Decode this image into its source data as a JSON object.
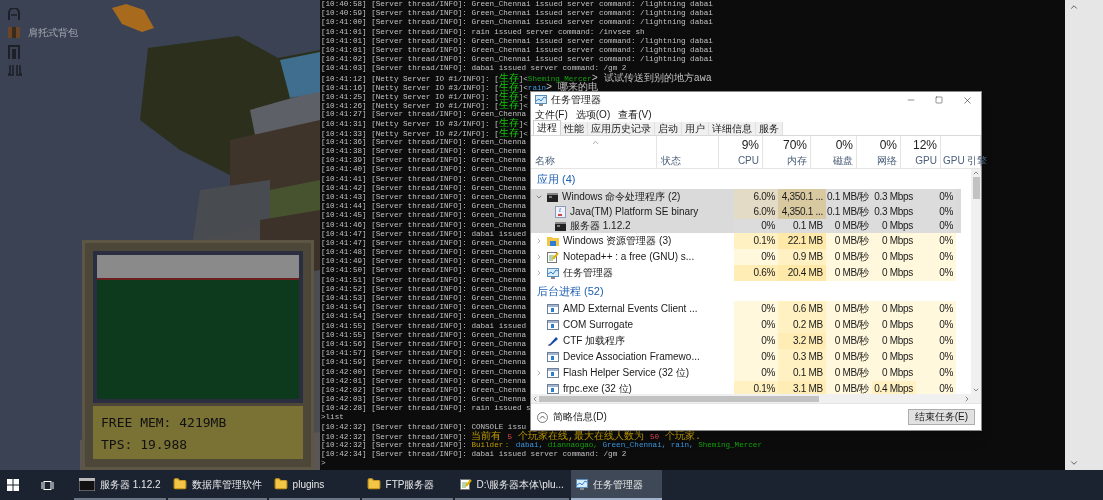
{
  "game": {
    "item_label": "肩托式背包",
    "free_mem": "FREE MEM: 4219MB",
    "tps": "TPS: 19.988"
  },
  "console": {
    "lines": [
      {
        "text": "[10:40:58] [Server thread/INFO]: Green_Chennai issued server command: /lightning dabai"
      },
      {
        "text": "[10:40:59] [Server thread/INFO]: Green_Chennai issued server command: /lightning dabai"
      },
      {
        "text": "[10:41:00] [Server thread/INFO]: Green_Chennai issued server command: /lightning dabai"
      },
      {
        "text": "[10:41:01] [Server thread/INFO]: rain issued server command: /invsee sh"
      },
      {
        "text": "[10:41:01] [Server thread/INFO]: Green_Chennai issued server command: /lightning dabai"
      },
      {
        "text": "[10:41:01] [Server thread/INFO]: Green_Chennai issued server command: /lightning dabai"
      },
      {
        "text": "[10:41:02] [Server thread/INFO]: Green_Chennai issued server command: /lightning dabai"
      },
      {
        "text": "[10:41:03] [Server thread/INFO]: dabai issued server command: /gm 2"
      },
      {
        "parts": [
          {
            "text": "[10:41:12] [Netty Server IO #1/INFO]: ["
          },
          {
            "text": "生存",
            "kind": "tag"
          },
          {
            "text": "]<"
          },
          {
            "text": "Sheming_Mercer",
            "kind": "player"
          },
          {
            "text": "> 试试传送到别的地方awa"
          }
        ]
      },
      {
        "parts": [
          {
            "text": "[10:41:16] [Netty Server IO #3/INFO]: ["
          },
          {
            "text": "生存",
            "kind": "tag"
          },
          {
            "text": "]<"
          },
          {
            "text": "rain",
            "kind": "operator"
          },
          {
            "text": "> 哪来的电"
          }
        ]
      },
      {
        "parts": [
          {
            "text": "[10:41:25] [Netty Server IO #1/INFO]: ["
          },
          {
            "text": "生存",
            "kind": "tag"
          },
          {
            "text": "]<"
          }
        ]
      },
      {
        "parts": [
          {
            "text": "[10:41:26] [Netty Server IO #1/INFO]: ["
          },
          {
            "text": "生存",
            "kind": "tag"
          },
          {
            "text": "]<"
          }
        ]
      },
      {
        "text": "[10:41:27] [Server thread/INFO]: Green_Chenna"
      },
      {
        "parts": [
          {
            "text": "[10:41:31] [Netty Server IO #3/INFO]: ["
          },
          {
            "text": "生存",
            "kind": "tag"
          },
          {
            "text": "]<"
          }
        ]
      },
      {
        "parts": [
          {
            "text": "[10:41:33] [Netty Server IO #2/INFO]: ["
          },
          {
            "text": "生存",
            "kind": "tag"
          },
          {
            "text": "]<"
          }
        ]
      },
      {
        "text": "[10:41:36] [Server thread/INFO]: Green_Chenna"
      },
      {
        "text": "[10:41:38] [Server thread/INFO]: Green_Chenna"
      },
      {
        "text": "[10:41:39] [Server thread/INFO]: Green_Chenna"
      },
      {
        "text": "[10:41:40] [Server thread/INFO]: Green_Chenna"
      },
      {
        "text": "[10:41:41] [Server thread/INFO]: Green_Chenna"
      },
      {
        "text": "[10:41:42] [Server thread/INFO]: Green_Chenna"
      },
      {
        "text": "[10:41:43] [Server thread/INFO]: Green_Chenna"
      },
      {
        "text": "[10:41:44] [Server thread/INFO]: Green_Chenna"
      },
      {
        "text": "[10:41:45] [Server thread/INFO]: Green_Chenna"
      },
      {
        "text": "[10:41:46] [Server thread/INFO]: Green_Chenna"
      },
      {
        "text": "[10:41:47] [Server thread/INFO]: dabai issued"
      },
      {
        "text": "[10:41:47] [Server thread/INFO]: Green_Chenna"
      },
      {
        "text": "[10:41:48] [Server thread/INFO]: Green_Chenna"
      },
      {
        "text": "[10:41:49] [Server thread/INFO]: Green_Chenna"
      },
      {
        "text": "[10:41:50] [Server thread/INFO]: Green_Chenna"
      },
      {
        "text": "[10:41:51] [Server thread/INFO]: Green_Chenna"
      },
      {
        "text": "[10:41:52] [Server thread/INFO]: Green_Chenna"
      },
      {
        "text": "[10:41:53] [Server thread/INFO]: Green_Chenna"
      },
      {
        "text": "[10:41:54] [Server thread/INFO]: Green_Chenna"
      },
      {
        "text": "[10:41:54] [Server thread/INFO]: Green_Chenna"
      },
      {
        "text": "[10:41:55] [Server thread/INFO]: dabai issued"
      },
      {
        "text": "[10:41:55] [Server thread/INFO]: Green_Chenna"
      },
      {
        "text": "[10:41:56] [Server thread/INFO]: Green_Chenna"
      },
      {
        "text": "[10:41:57] [Server thread/INFO]: Green_Chenna"
      },
      {
        "text": "[10:41:59] [Server thread/INFO]: Green_Chenna"
      },
      {
        "text": "[10:42:00] [Server thread/INFO]: Green_Chenna"
      },
      {
        "text": "[10:42:01] [Server thread/INFO]: Green_Chenna"
      },
      {
        "text": "[10:42:02] [Server thread/INFO]: Green_Chenna"
      },
      {
        "text": "[10:42:03] [Server thread/INFO]: Green_Chenna"
      },
      {
        "text": "[10:42:28] [Server thread/INFO]: rain issued s"
      },
      {
        "text": ">list"
      },
      {
        "text": "[10:42:32] [Server thread/INFO]: CONSOLE issu"
      },
      {
        "parts": [
          {
            "text": "[10:42:32] [Server thread/INFO]: "
          },
          {
            "text": "当前有 ",
            "kind": "notice"
          },
          {
            "text": "5",
            "kind": "number"
          },
          {
            "text": " 个玩家在线,最大在线人数为 ",
            "kind": "notice"
          },
          {
            "text": "50",
            "kind": "number"
          },
          {
            "text": " 个玩家.",
            "kind": "notice"
          }
        ]
      },
      {
        "parts": [
          {
            "text": "[10:42:32] [Server thread/INFO]: "
          },
          {
            "text": "Builder： ",
            "kind": "notice"
          },
          {
            "text": "dabai, ",
            "kind": "operator"
          },
          {
            "text": "diannaogao, ",
            "kind": "player"
          },
          {
            "text": "Green_Chennai, rain, ",
            "kind": "operator"
          },
          {
            "text": "Sheming_Mercer",
            "kind": "player"
          }
        ]
      },
      {
        "text": "[10:42:34] [Server thread/INFO]: dabai issued server command: /gm 2"
      },
      {
        "text": ">"
      }
    ]
  },
  "task_manager": {
    "title": "任务管理器",
    "menu": [
      "文件(F)",
      "选项(O)",
      "查看(V)"
    ],
    "tabs": [
      {
        "label": "进程",
        "selected": true
      },
      {
        "label": "性能",
        "selected": false
      },
      {
        "label": "应用历史记录",
        "selected": false
      },
      {
        "label": "启动",
        "selected": false
      },
      {
        "label": "用户",
        "selected": false
      },
      {
        "label": "详细信息",
        "selected": false
      },
      {
        "label": "服务",
        "selected": false
      }
    ],
    "name_column": "名称",
    "status_column": "状态",
    "columns": [
      {
        "percent": "9%",
        "label": "CPU"
      },
      {
        "percent": "70%",
        "label": "内存"
      },
      {
        "percent": "0%",
        "label": "磁盘"
      },
      {
        "percent": "0%",
        "label": "网络"
      },
      {
        "percent": "12%",
        "label": "GPU"
      },
      {
        "label": "GPU 引擎"
      }
    ],
    "rows": [
      {
        "kind": "group",
        "name": "应用 (4)"
      },
      {
        "kind": "process",
        "name": "Windows 命令处理程序 (2)",
        "expanded": true,
        "selected": true,
        "cells": [
          {
            "text": "6.0%",
            "color": "#e3dbc5"
          },
          {
            "text": "4,350.1 ...",
            "color": "#d8c9a0"
          },
          {
            "text": "0.1 MB/秒",
            "color": "#dcdcdc"
          },
          {
            "text": "0.3 Mbps",
            "color": "#dcdcdc"
          },
          {
            "text": "0%",
            "color": "#dcdcdc"
          }
        ]
      },
      {
        "kind": "child",
        "name": "Java(TM) Platform SE binary",
        "selected": true,
        "cells": [
          {
            "text": "6.0%",
            "color": "#e3dbc5"
          },
          {
            "text": "4,350.1 ...",
            "color": "#d8c9a0"
          },
          {
            "text": "0.1 MB/秒",
            "color": "#dcdcdc"
          },
          {
            "text": "0.3 Mbps",
            "color": "#dcdcdc"
          },
          {
            "text": "0%",
            "color": "#dcdcdc"
          }
        ]
      },
      {
        "kind": "child",
        "name": "服务器 1.12.2",
        "selected": true,
        "cells": [
          {
            "text": "0%",
            "color": "#dcdcdc"
          },
          {
            "text": "0.1 MB",
            "color": "#dcdcdc"
          },
          {
            "text": "0 MB/秒",
            "color": "#dcdcdc"
          },
          {
            "text": "0 Mbps",
            "color": "#dcdcdc"
          },
          {
            "text": "0%",
            "color": "#dcdcdc"
          }
        ]
      },
      {
        "kind": "process",
        "name": "Windows 资源管理器 (3)",
        "expanded": false,
        "selected": false,
        "cells": [
          {
            "text": "0.1%",
            "color": "#fff1c2"
          },
          {
            "text": "22.1 MB",
            "color": "#ffe9a8"
          },
          {
            "text": "0 MB/秒",
            "color": "#fff8dc"
          },
          {
            "text": "0 Mbps",
            "color": "#fff8dc"
          },
          {
            "text": "0%",
            "color": "#fff8dc"
          }
        ]
      },
      {
        "kind": "process",
        "name": "Notepad++ : a free (GNU) s...",
        "expanded": false,
        "selected": false,
        "cells": [
          {
            "text": "0%",
            "color": "#fff8dc"
          },
          {
            "text": "0.9 MB",
            "color": "#fff1c2"
          },
          {
            "text": "0 MB/秒",
            "color": "#fff8dc"
          },
          {
            "text": "0 Mbps",
            "color": "#fff8dc"
          },
          {
            "text": "0%",
            "color": "#fff8dc"
          }
        ]
      },
      {
        "kind": "process",
        "name": "任务管理器",
        "expanded": false,
        "selected": false,
        "cells": [
          {
            "text": "0.6%",
            "color": "#ffedb5"
          },
          {
            "text": "20.4 MB",
            "color": "#ffe9a8"
          },
          {
            "text": "0 MB/秒",
            "color": "#fff8dc"
          },
          {
            "text": "0 Mbps",
            "color": "#fff8dc"
          },
          {
            "text": "0%",
            "color": "#fff8dc"
          }
        ]
      },
      {
        "kind": "group",
        "name": "后台进程 (52)"
      },
      {
        "kind": "process",
        "name": "AMD External Events Client ...",
        "selected": false,
        "cells": [
          {
            "text": "0%",
            "color": "#fff8dc"
          },
          {
            "text": "0.6 MB",
            "color": "#fff1c2"
          },
          {
            "text": "0 MB/秒",
            "color": "#fff8dc"
          },
          {
            "text": "0 Mbps",
            "color": "#fff8dc"
          },
          {
            "text": "0%",
            "color": "#fff8dc"
          }
        ]
      },
      {
        "kind": "process",
        "name": "COM Surrogate",
        "selected": false,
        "cells": [
          {
            "text": "0%",
            "color": "#fff8dc"
          },
          {
            "text": "0.2 MB",
            "color": "#fff1c2"
          },
          {
            "text": "0 MB/秒",
            "color": "#fff8dc"
          },
          {
            "text": "0 Mbps",
            "color": "#fff8dc"
          },
          {
            "text": "0%",
            "color": "#fff8dc"
          }
        ]
      },
      {
        "kind": "process",
        "name": "CTF 加载程序",
        "selected": false,
        "cells": [
          {
            "text": "0%",
            "color": "#fff8dc"
          },
          {
            "text": "3.2 MB",
            "color": "#ffedb5"
          },
          {
            "text": "0 MB/秒",
            "color": "#fff8dc"
          },
          {
            "text": "0 Mbps",
            "color": "#fff8dc"
          },
          {
            "text": "0%",
            "color": "#fff8dc"
          }
        ]
      },
      {
        "kind": "process",
        "name": "Device Association Framewo...",
        "selected": false,
        "cells": [
          {
            "text": "0%",
            "color": "#fff8dc"
          },
          {
            "text": "0.3 MB",
            "color": "#fff1c2"
          },
          {
            "text": "0 MB/秒",
            "color": "#fff8dc"
          },
          {
            "text": "0 Mbps",
            "color": "#fff8dc"
          },
          {
            "text": "0%",
            "color": "#fff8dc"
          }
        ]
      },
      {
        "kind": "process",
        "name": "Flash Helper Service (32 位)",
        "expanded": false,
        "selected": false,
        "cells": [
          {
            "text": "0%",
            "color": "#fff8dc"
          },
          {
            "text": "0.1 MB",
            "color": "#fff1c2"
          },
          {
            "text": "0 MB/秒",
            "color": "#fff8dc"
          },
          {
            "text": "0 Mbps",
            "color": "#fff8dc"
          },
          {
            "text": "0%",
            "color": "#fff8dc"
          }
        ]
      },
      {
        "kind": "process",
        "name": "frpc.exe (32 位)",
        "selected": false,
        "cells": [
          {
            "text": "0.1%",
            "color": "#fff1c2"
          },
          {
            "text": "3.1 MB",
            "color": "#ffedb5"
          },
          {
            "text": "0 MB/秒",
            "color": "#fff8dc"
          },
          {
            "text": "0.4 Mbps",
            "color": "#fff1c2"
          },
          {
            "text": "0%",
            "color": "#fff8dc"
          }
        ]
      }
    ],
    "fewer_details": "简略信息(D)",
    "end_task": "结束任务(E)"
  },
  "taskbar": {
    "items": [
      {
        "label": "服务器 1.12.2",
        "selected": false
      },
      {
        "label": "数据库管理软件",
        "selected": false
      },
      {
        "label": "plugins",
        "selected": false
      },
      {
        "label": "FTP服务器",
        "selected": false
      },
      {
        "label": "D:\\服务器本体\\plu...",
        "selected": false
      },
      {
        "label": "任务管理器",
        "selected": true
      }
    ]
  }
}
